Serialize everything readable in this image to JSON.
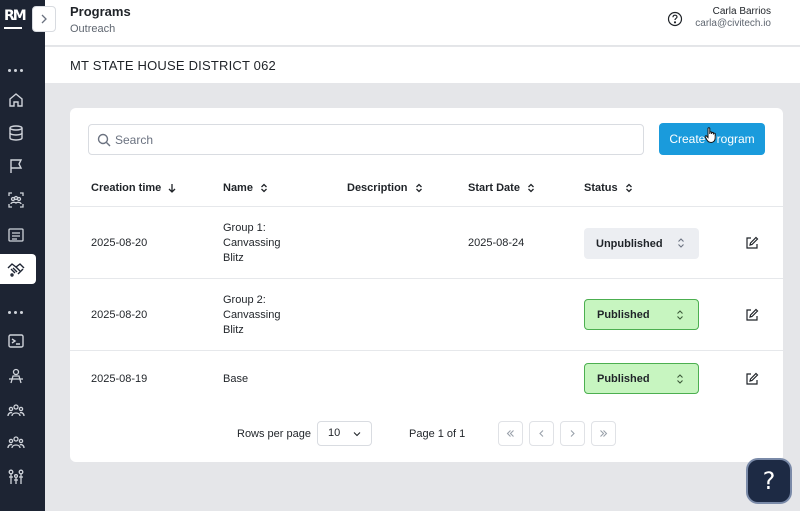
{
  "app": {
    "logo_text": "RM"
  },
  "header": {
    "title": "Programs",
    "subtitle": "Outreach",
    "user_name": "Carla Barrios",
    "user_email": "carla@civitech.io"
  },
  "district": {
    "title": "MT STATE HOUSE DISTRICT 062"
  },
  "sidebar": {
    "icons": [
      "more-dots-icon",
      "home-icon",
      "database-icon",
      "flag-icon",
      "people-scan-icon",
      "list-icon",
      "handshake-icon",
      "more-dots-icon",
      "terminal-icon",
      "organizer-icon",
      "group-icon",
      "team-icon",
      "family-icon"
    ],
    "active": "handshake-icon"
  },
  "search": {
    "placeholder": "Search",
    "value": ""
  },
  "toolbar": {
    "create_label": "Create Program"
  },
  "table": {
    "columns": [
      {
        "label": "Creation time",
        "sort": "desc"
      },
      {
        "label": "Name",
        "sort": "both"
      },
      {
        "label": "Description",
        "sort": "both"
      },
      {
        "label": "Start Date",
        "sort": "both"
      },
      {
        "label": "Status",
        "sort": "both"
      }
    ],
    "rows": [
      {
        "created": "2025-08-20",
        "name_lines": [
          "Group 1:",
          "Canvassing",
          "Blitz"
        ],
        "description": "",
        "start_date": "2025-08-24",
        "status": "Unpublished"
      },
      {
        "created": "2025-08-20",
        "name_lines": [
          "Group 2:",
          "Canvassing",
          "Blitz"
        ],
        "description": "",
        "start_date": "",
        "status": "Published"
      },
      {
        "created": "2025-08-19",
        "name_lines": [
          "Base"
        ],
        "description": "",
        "start_date": "",
        "status": "Published"
      }
    ]
  },
  "pagination": {
    "rows_per_page_label": "Rows per page",
    "rows_per_page": "10",
    "page_label": "Page 1 of 1"
  },
  "help": {
    "label": "?"
  },
  "colors": {
    "accent": "#1a9bdc",
    "sidebar": "#1d2433",
    "published_bg": "#c7f5c0",
    "published_border": "#4caf50",
    "unpublished_bg": "#eceef2"
  }
}
